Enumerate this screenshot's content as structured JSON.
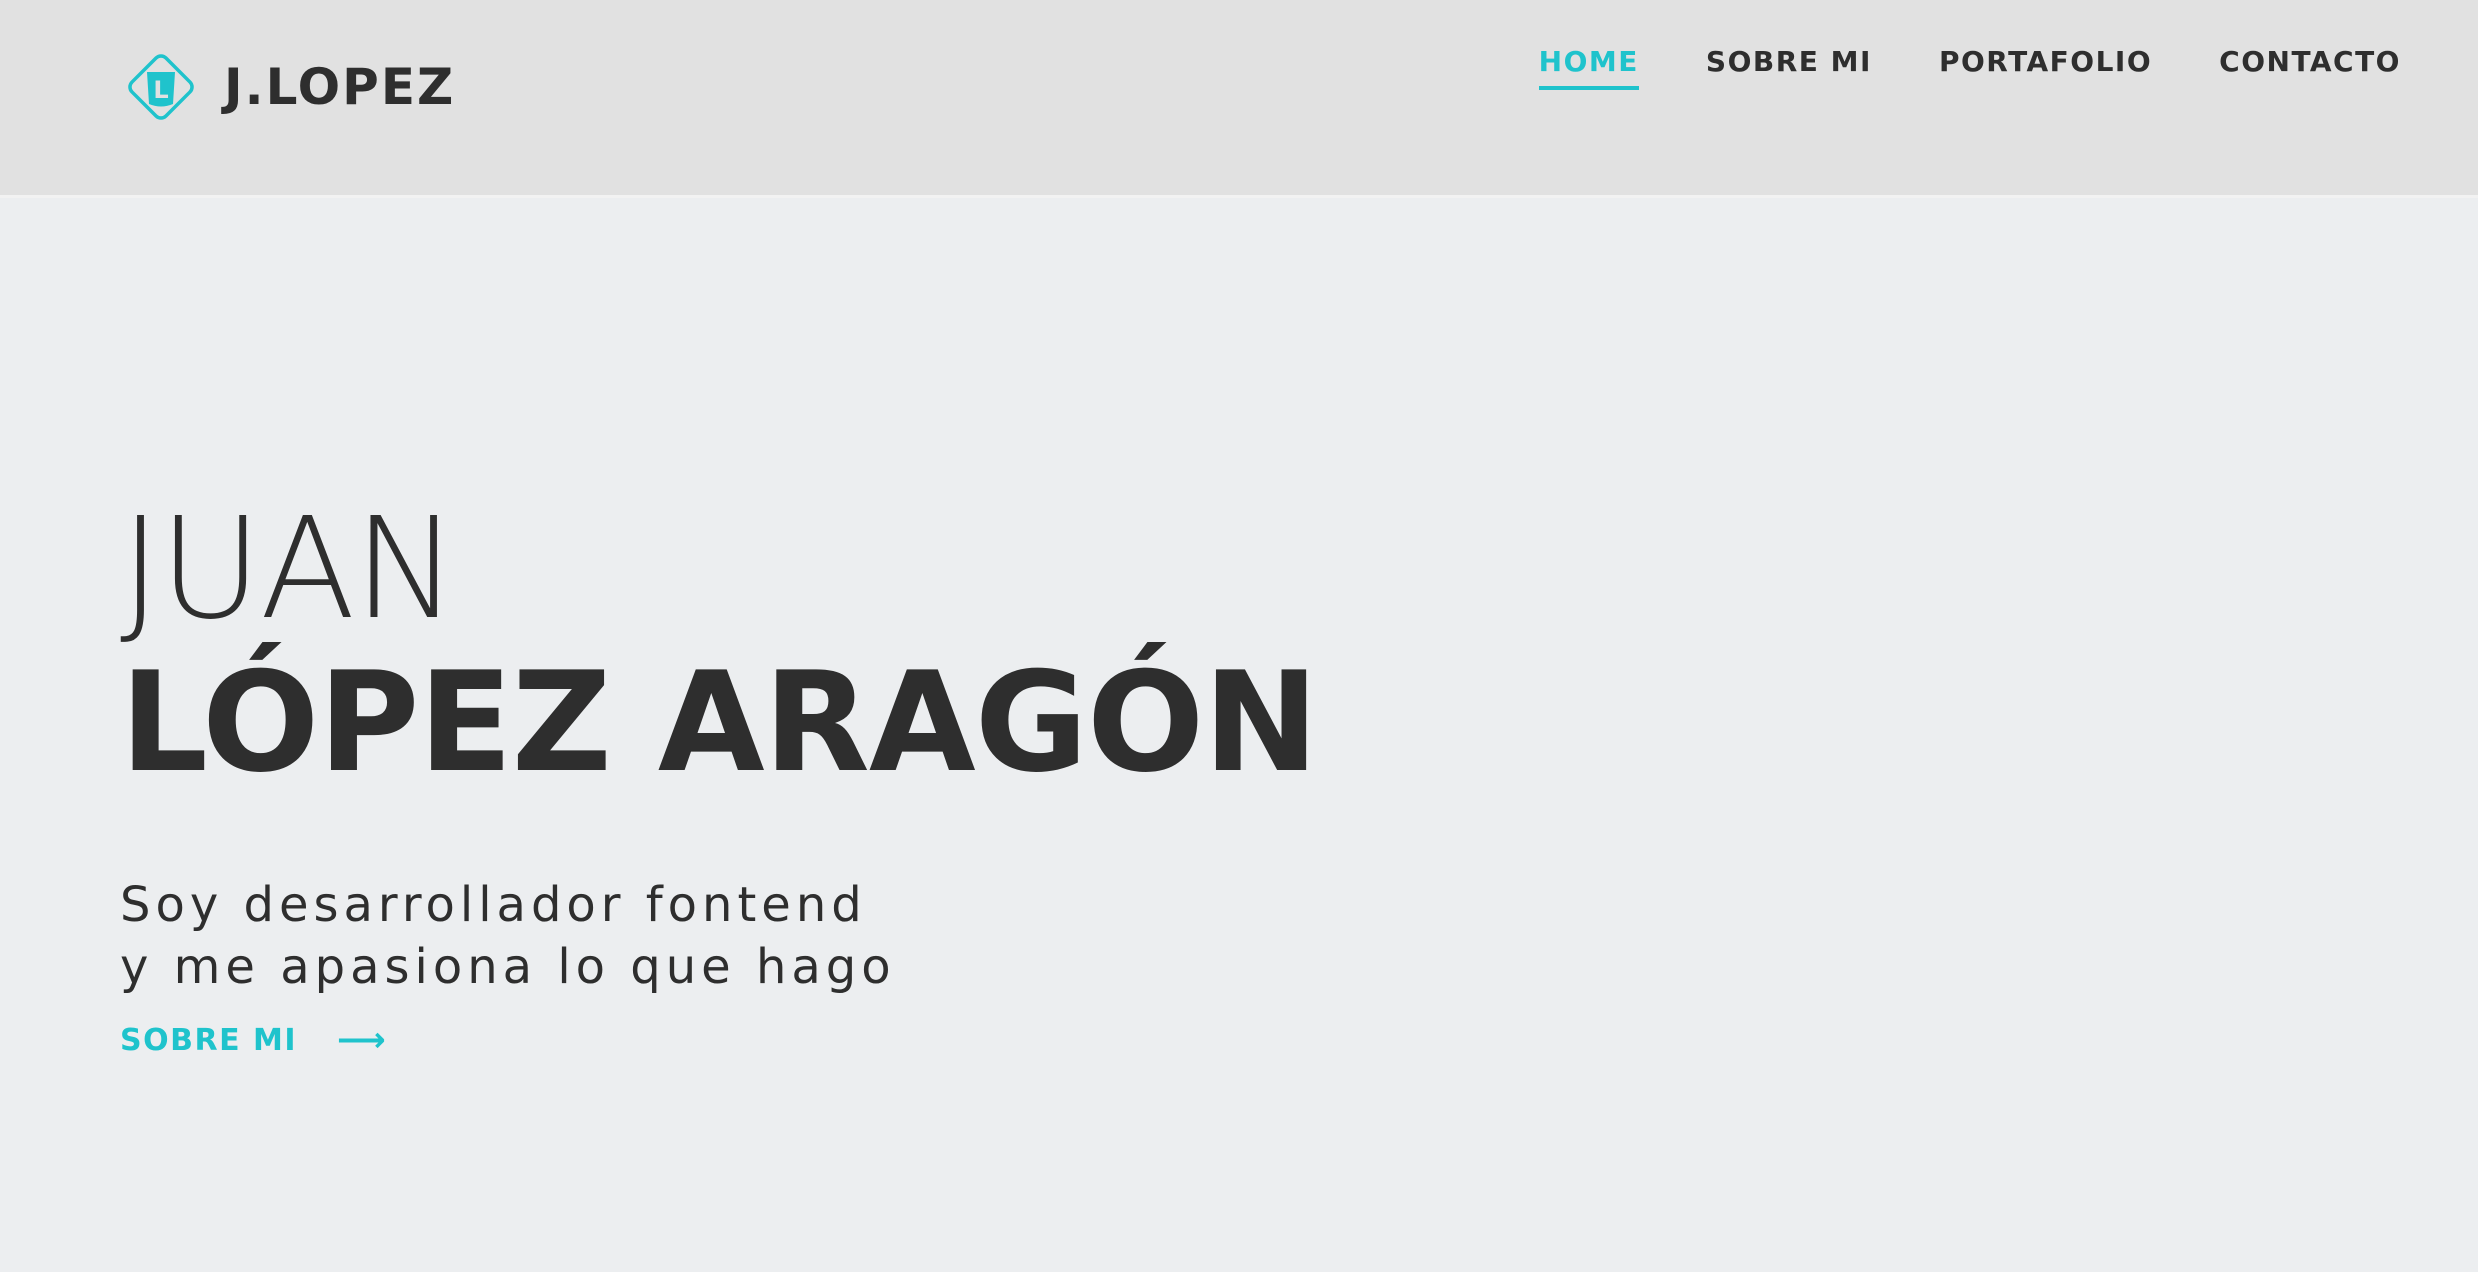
{
  "header": {
    "brand": "J.LOPEZ",
    "logo_letter": "L",
    "nav": [
      {
        "label": "HOME",
        "active": true
      },
      {
        "label": "SOBRE MI",
        "active": false
      },
      {
        "label": "PORTAFOLIO",
        "active": false
      },
      {
        "label": "CONTACTO",
        "active": false
      }
    ]
  },
  "hero": {
    "first_name": "JUAN",
    "last_name": "LÓPEZ ARAGÓN",
    "tagline_line1": "Soy desarrollador fontend",
    "tagline_line2": "y me apasiona lo que hago",
    "cta_label": "SOBRE MI",
    "cta_icon": "arrow-right-icon"
  },
  "colors": {
    "accent": "#1fc3cc",
    "text": "#2e2e2e",
    "header_bg": "#e1e1e1",
    "page_bg": "#eceef0"
  }
}
